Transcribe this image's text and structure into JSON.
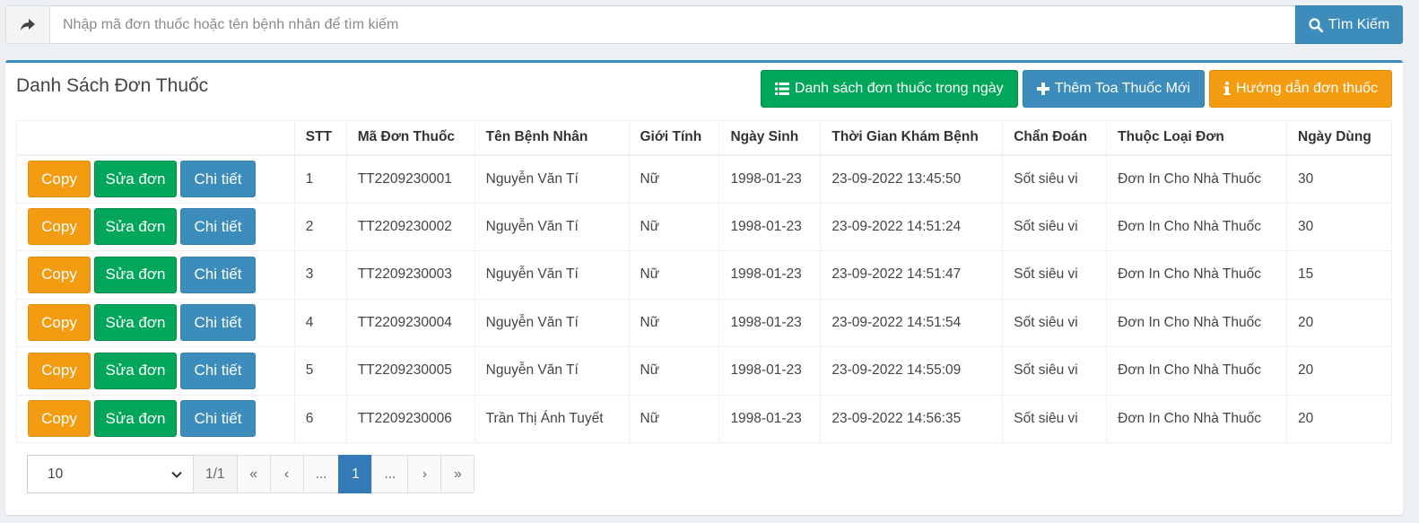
{
  "search": {
    "placeholder": "Nhập mã đơn thuốc hoặc tên bệnh nhân để tìm kiếm",
    "button_label": "Tìm Kiếm"
  },
  "box": {
    "title": "Danh Sách Đơn Thuốc",
    "tools": {
      "today_list": "Danh sách đơn thuốc trong ngày",
      "add_new": "Thêm Toa Thuốc Mới",
      "guide": "Hướng dẫn đơn thuốc"
    }
  },
  "table": {
    "headers": [
      "",
      "STT",
      "Mã Đơn Thuốc",
      "Tên Bệnh Nhân",
      "Giới Tính",
      "Ngày Sinh",
      "Thời Gian Khám Bệnh",
      "Chẩn Đoán",
      "Thuộc Loại Đơn",
      "Ngày Dùng"
    ],
    "action_labels": {
      "copy": "Copy",
      "edit": "Sửa đơn",
      "detail": "Chi tiết"
    },
    "rows": [
      {
        "stt": "1",
        "code": "TT2209230001",
        "name": "Nguyễn Văn Tí",
        "gender": "Nữ",
        "dob": "1998-01-23",
        "time": "23-09-2022 13:45:50",
        "diagnosis": "Sốt siêu vi",
        "type": "Đơn In Cho Nhà Thuốc",
        "days": "30"
      },
      {
        "stt": "2",
        "code": "TT2209230002",
        "name": "Nguyễn Văn Tí",
        "gender": "Nữ",
        "dob": "1998-01-23",
        "time": "23-09-2022 14:51:24",
        "diagnosis": "Sốt siêu vi",
        "type": "Đơn In Cho Nhà Thuốc",
        "days": "30"
      },
      {
        "stt": "3",
        "code": "TT2209230003",
        "name": "Nguyễn Văn Tí",
        "gender": "Nữ",
        "dob": "1998-01-23",
        "time": "23-09-2022 14:51:47",
        "diagnosis": "Sốt siêu vi",
        "type": "Đơn In Cho Nhà Thuốc",
        "days": "15"
      },
      {
        "stt": "4",
        "code": "TT2209230004",
        "name": "Nguyễn Văn Tí",
        "gender": "Nữ",
        "dob": "1998-01-23",
        "time": "23-09-2022 14:51:54",
        "diagnosis": "Sốt siêu vi",
        "type": "Đơn In Cho Nhà Thuốc",
        "days": "20"
      },
      {
        "stt": "5",
        "code": "TT2209230005",
        "name": "Nguyễn Văn Tí",
        "gender": "Nữ",
        "dob": "1998-01-23",
        "time": "23-09-2022 14:55:09",
        "diagnosis": "Sốt siêu vi",
        "type": "Đơn In Cho Nhà Thuốc",
        "days": "20"
      },
      {
        "stt": "6",
        "code": "TT2209230006",
        "name": "Trần Thị Ánh Tuyết",
        "gender": "Nữ",
        "dob": "1998-01-23",
        "time": "23-09-2022 14:56:35",
        "diagnosis": "Sốt siêu vi",
        "type": "Đơn In Cho Nhà Thuốc",
        "days": "20"
      }
    ]
  },
  "pagination": {
    "page_size": "10",
    "page_info": "1/1",
    "first": "«",
    "prev": "‹",
    "ellipsis_left": "...",
    "current": "1",
    "ellipsis_right": "...",
    "next": "›",
    "last": "»"
  },
  "colors": {
    "primary": "#3c8dbc",
    "success": "#00a65a",
    "warning": "#f39c12",
    "active_page": "#337ab7"
  }
}
